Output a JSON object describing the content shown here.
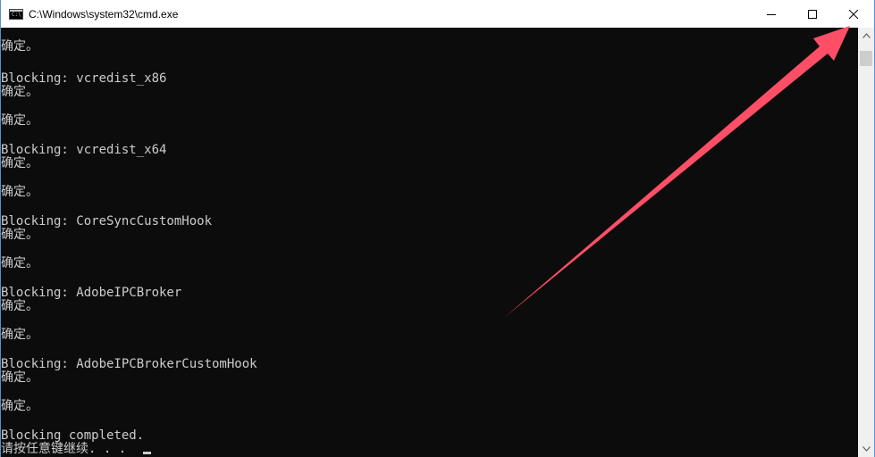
{
  "window": {
    "title": "C:\\Windows\\system32\\cmd.exe",
    "icon_text": "C:\\",
    "icons": [
      "cmd-app-icon",
      "minimize-icon",
      "maximize-icon",
      "close-icon",
      "scroll-up-arrow-icon",
      "scroll-down-arrow-icon"
    ],
    "accent_color": "#5a8dd6",
    "arrow_color": "#ff4f67"
  },
  "console": {
    "foreground": "#cccccc",
    "background": "#0c0c0c",
    "lines": [
      "确定。",
      "",
      "Blocking: vcredist_x86",
      "确定。",
      "",
      "确定。",
      "",
      "Blocking: vcredist_x64",
      "确定。",
      "",
      "确定。",
      "",
      "Blocking: CoreSyncCustomHook",
      "确定。",
      "",
      "确定。",
      "",
      "Blocking: AdobeIPCBroker",
      "确定。",
      "",
      "确定。",
      "",
      "Blocking: AdobeIPCBrokerCustomHook",
      "确定。",
      "",
      "确定。",
      "",
      "Blocking completed.",
      "请按任意键继续. . ."
    ]
  }
}
